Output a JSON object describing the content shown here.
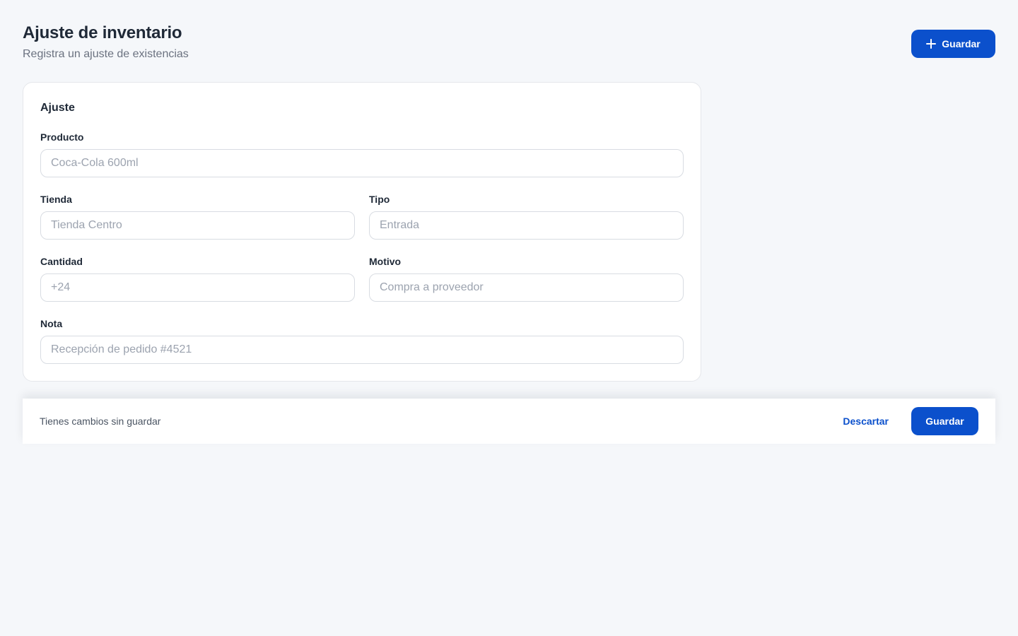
{
  "header": {
    "title": "Ajuste de inventario",
    "subtitle": "Registra un ajuste de existencias",
    "save_label": "Guardar"
  },
  "card": {
    "title": "Ajuste",
    "fields": {
      "producto": {
        "label": "Producto",
        "placeholder": "Coca-Cola 600ml"
      },
      "tienda": {
        "label": "Tienda",
        "placeholder": "Tienda Centro"
      },
      "tipo": {
        "label": "Tipo",
        "placeholder": "Entrada"
      },
      "cantidad": {
        "label": "Cantidad",
        "placeholder": "+24"
      },
      "motivo": {
        "label": "Motivo",
        "placeholder": "Compra a proveedor"
      },
      "nota": {
        "label": "Nota",
        "placeholder": "Recepción de pedido #4521"
      }
    }
  },
  "save_bar": {
    "message": "Tienes cambios sin guardar",
    "discard_label": "Descartar",
    "save_label": "Guardar"
  },
  "colors": {
    "primary": "#0b50cc",
    "background": "#f5f7fa"
  },
  "icons": {
    "header_save": "plus-icon"
  }
}
